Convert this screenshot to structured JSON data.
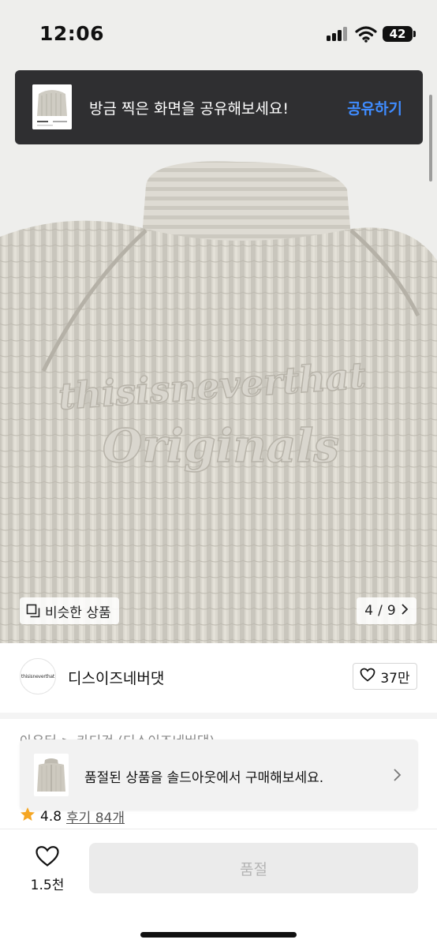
{
  "status_bar": {
    "time": "12:06",
    "battery": "42",
    "icons": [
      "signal-icon",
      "wifi-icon",
      "battery-icon"
    ]
  },
  "share_toast": {
    "message": "방금 찍은 화면을 공유해보세요!",
    "action": "공유하기",
    "accent_color": "#3f8cff"
  },
  "product_image": {
    "embroidery_text_top": "thisisneverthat",
    "embroidery_text_bottom": "Originals",
    "similar_products_label": "비슷한 상품",
    "pager": {
      "current": "4",
      "separator": "/",
      "total": "9"
    }
  },
  "brand": {
    "logo_text": "thisisneverthat",
    "name": "디스이즈네버댓",
    "like_count": "37만"
  },
  "category": {
    "text": "아우터 > 카디건 (디스이즈네버댓)"
  },
  "soldout_banner": {
    "message": "품절된 상품을 솔드아웃에서 구매해보세요."
  },
  "rating": {
    "value": "4.8",
    "reviews": "후기 84개",
    "star_color": "#f5a623"
  },
  "bottom_bar": {
    "wish_count": "1.5천",
    "buy_label": "품절"
  }
}
